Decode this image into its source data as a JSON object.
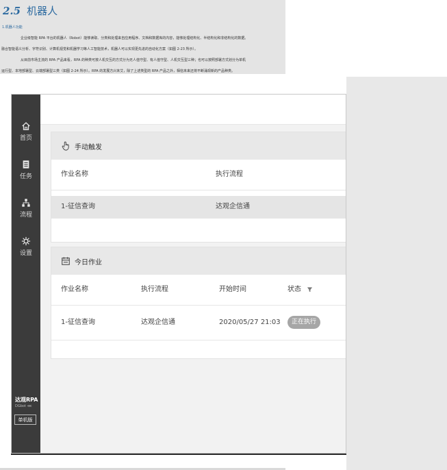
{
  "doc": {
    "section_number": "2.5",
    "section_title": "机器人",
    "subsection": "1.机器人功能",
    "lines": [
      "企业级智能 RPA 平台的机器人（Robot）能够读取、分类和处理来自应用程序、文档和数据库的内容，能够处理结构化、半结构化和非结构化的数据。",
      "融合智能语义分析、字符识别、计算机视觉和机器学习等人工智能技术，机器人可以实现更先进的自动化方案（如图 2-23 所示）。",
      "从目前市场主流的 RPA 产品来看，RPA 的种类可按人机交互的方式分为无人值守型、有人值守型、人机交互型三种；也可以按照部署方式划分为单机",
      "运行型、本地部署型、云端部署型三类（如图 2-24 所示）。RPA 的发展方兴未艾，除了上述类型的 RPA 产品之外，相信未来还将不断涌现新的产品种类。"
    ]
  },
  "sidebar": {
    "items": [
      {
        "label": "首页",
        "icon": "home-icon"
      },
      {
        "label": "任务",
        "icon": "document-icon"
      },
      {
        "label": "流程",
        "icon": "flow-icon"
      },
      {
        "label": "设置",
        "icon": "gear-icon"
      }
    ],
    "brand_name": "达观RPA",
    "brand_sub": "DGbot ⋘",
    "edition": "单机版"
  },
  "manual": {
    "title": "手动触发",
    "icon": "hand-pointer-icon",
    "columns": [
      "作业名称",
      "执行流程"
    ],
    "rows": [
      {
        "name": "1-征信查询",
        "flow": "达观企信通"
      }
    ]
  },
  "today": {
    "title": "今日作业",
    "icon": "calendar-icon",
    "columns": [
      "作业名称",
      "执行流程",
      "开始时间",
      "状态"
    ],
    "filter_icon": "filter-icon",
    "rows": [
      {
        "name": "1-征信查询",
        "flow": "达观企信通",
        "start": "2020/05/27 21:03",
        "status": "正在执行"
      }
    ]
  },
  "colors": {
    "sidebar_bg": "#3b3b3b",
    "header_bg": "#e8e8e8",
    "status_badge": "#a6a6a6",
    "doc_accent": "#2c6aa0"
  }
}
